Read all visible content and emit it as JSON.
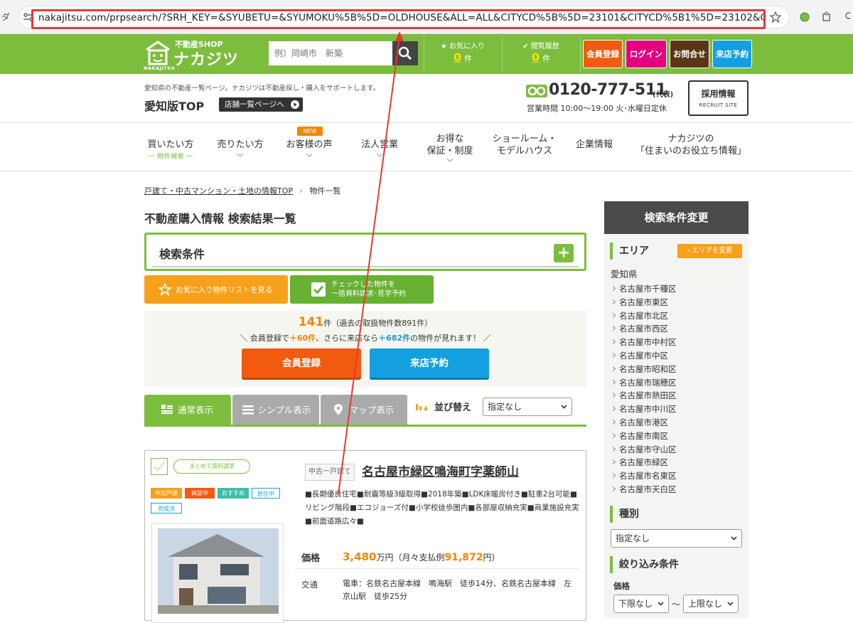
{
  "browser": {
    "url": "nakajitsu.com/prpsearch/?SRH_KEY=&SYUBETU=&SYUMOKU%5B%5D=OLDHOUSE&ALL=ALL&CITYCD%5B%5D=23101&CITYCD%5B1%5D=23102&CITYCD%5B2%5D=23103&CI..."
  },
  "header": {
    "logo_small": "不動産SHOP",
    "logo_main": "ナカジツ",
    "logo_roman": "NAKAJITSU",
    "search_placeholder": "例）岡崎市　新築",
    "favorites_label": "お気に入り",
    "favorites_count": "0",
    "history_label": "閲覧履歴",
    "history_count": "0",
    "count_unit": "件",
    "buttons": {
      "register": "会員登録",
      "login": "ログイン",
      "contact": "お問合せ",
      "visit": "来店予約"
    },
    "colors": {
      "green": "#7cbd3e",
      "register": "#f25b0f",
      "login": "#e5007f",
      "contact": "#5a3714",
      "visit": "#14a0e0"
    }
  },
  "subheader": {
    "tagline": "愛知県の不動産一覧ページ。ナカジツは不動産探し・購入をサポートします。",
    "title": "愛知版TOP",
    "store_button": "店舗一覧ページへ",
    "phone": "0120-777-511",
    "phone_note": "(代表)",
    "hours": "営業時間 10:00～19:00 火･水曜日定休",
    "recruit_main": "採用情報",
    "recruit_sub": "RECRUIT SITE"
  },
  "nav": {
    "items": [
      {
        "label": "買いたい方",
        "sub": "一 物件検索 一"
      },
      {
        "label": "売りたい方"
      },
      {
        "label": "お客様の声",
        "badge": "NEW"
      },
      {
        "label": "法人営業"
      },
      {
        "label": "お得な",
        "label2": "保証・制度"
      },
      {
        "label": "ショールーム・",
        "label2": "モデルハウス"
      },
      {
        "label": "企業情報"
      },
      {
        "label": "ナカジツの",
        "label2": "「住まいのお役立ち情報」"
      }
    ]
  },
  "main": {
    "breadcrumb_link": "戸建て・中古マンション・土地の情報TOP",
    "breadcrumb_sep": "›",
    "breadcrumb_current": "物件一覧",
    "page_title": "不動産購入情報 検索結果一覧",
    "conditions_title": "検索条件",
    "conditions_toggle": "+",
    "fav_list_button": "お気に入り物件リストを見る",
    "check_button_line1": "チェックした物件を",
    "check_button_line2": "一括資料請求･見学予約",
    "result_count": "141",
    "result_unit": "件",
    "result_note": "（過去の取扱物件数891件）",
    "member_pre": "＼ 会員登録で",
    "member_plus": "＋60件",
    "member_mid": "、さらに来店なら",
    "member_plus2": "＋682件",
    "member_post": "の物件が見れます！ ／",
    "register_button": "会員登録",
    "visit_button": "来店予約",
    "tabs": [
      "通常表示",
      "シンプル表示",
      "マップ表示"
    ],
    "sort_label": "並び替え",
    "sort_value": "指定なし"
  },
  "card": {
    "batch_label": "まとめて資料請求",
    "tags": [
      "中古戸建",
      "商談中",
      "おすすめ",
      "居住中",
      "完成済"
    ],
    "type": "中古一戸建て",
    "title": "名古屋市緑区鳴海町字薬師山",
    "features": "■長期優良住宅■耐震等級3級取得■2018年築■LDK床暖房付き■駐車2台可能■リビング階段■エコジョーズ付■小学校徒歩圏内■各部屋収納充実■商業施設充実■前面道路広々■",
    "price_label": "価格",
    "price": "3,480",
    "price_unit": "万円",
    "monthly_pre": "（月々支払例",
    "monthly": "91,872",
    "monthly_post": "円）",
    "access_label": "交通",
    "access": "電車：名鉄名古屋本線　鳴海駅　徒歩14分、名鉄名古屋本線　左京山駅　徒歩25分"
  },
  "sidebar": {
    "title": "検索条件変更",
    "area_heading": "エリア",
    "area_change": "エリアを変更",
    "prefecture": "愛知県",
    "cities": [
      "名古屋市千種区",
      "名古屋市東区",
      "名古屋市北区",
      "名古屋市西区",
      "名古屋市中村区",
      "名古屋市中区",
      "名古屋市昭和区",
      "名古屋市瑞穂区",
      "名古屋市熱田区",
      "名古屋市中川区",
      "名古屋市港区",
      "名古屋市南区",
      "名古屋市守山区",
      "名古屋市緑区",
      "名古屋市名東区",
      "名古屋市天白区"
    ],
    "type_heading": "種別",
    "type_value": "指定なし",
    "filter_heading": "絞り込み条件",
    "price_heading": "価格",
    "price_min": "下限なし",
    "price_max": "上限なし",
    "tilde": "〜"
  }
}
